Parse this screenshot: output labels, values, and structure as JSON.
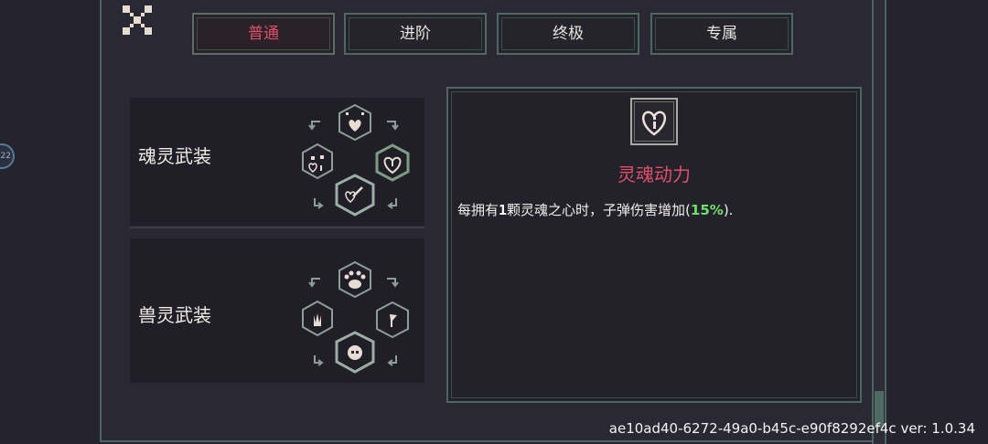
{
  "tabs": [
    {
      "label": "普通",
      "active": true
    },
    {
      "label": "进阶",
      "active": false
    },
    {
      "label": "终极",
      "active": false
    },
    {
      "label": "专属",
      "active": false
    }
  ],
  "sets": [
    {
      "name": "魂灵武装"
    },
    {
      "name": "兽灵武装"
    }
  ],
  "detail": {
    "skill_name": "灵魂动力",
    "desc_prefix": "每拥有",
    "desc_count": "1",
    "desc_middle": "颗灵魂之心时，子弹伤害增加(",
    "desc_value": "15%",
    "desc_suffix": ")."
  },
  "side_badge": "22",
  "version_text": "ae10ad40-6272-49a0-b45c-e90f8292ef4c ver: 1.0.34",
  "icons": {
    "close": "close-x-icon",
    "soul_heart": "soul-heart-icon"
  },
  "colors": {
    "accent_red": "#e0506a",
    "highlight_green": "#6fe06a",
    "frame_teal": "#4d6661"
  }
}
